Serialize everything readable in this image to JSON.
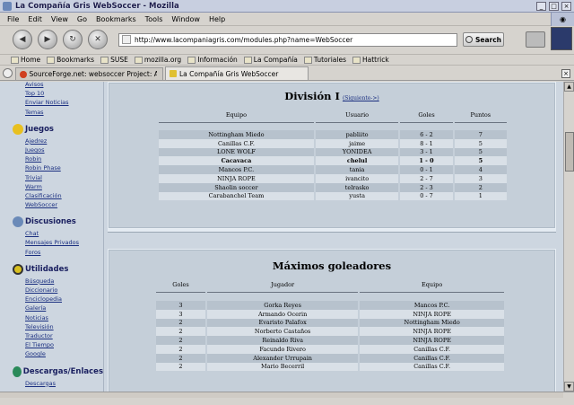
{
  "window": {
    "title": "La Compañía Gris WebSoccer - Mozilla"
  },
  "menu": [
    "File",
    "Edit",
    "View",
    "Go",
    "Bookmarks",
    "Tools",
    "Window",
    "Help"
  ],
  "nav": {
    "url": "http://www.lacompaniagris.com/modules.php?name=WebSoccer",
    "search_label": "Search"
  },
  "bookmarks": [
    "Home",
    "Bookmarks",
    "SUSE",
    "mozilla.org",
    "Información",
    "La Compañía",
    "Tutoriales",
    "Hattrick"
  ],
  "tabs": [
    "SourceForge.net: websoccer Project: A...",
    "La Compañía Gris WebSoccer"
  ],
  "sidebar": {
    "top_links": [
      "Avisos",
      "Top 10",
      "Enviar Noticias",
      "Temas"
    ],
    "sections": [
      {
        "title": "Juegos",
        "links": [
          "Ajedrez",
          "Juegos",
          "Robin",
          "Robin Phase",
          "Trivial",
          "Warm",
          "Clasificación",
          "WebSoccer"
        ]
      },
      {
        "title": "Discusiones",
        "links": [
          "Chat",
          "Mensajes Privados",
          "Foros"
        ]
      },
      {
        "title": "Utilidades",
        "links": [
          "Búsqueda",
          "Diccionario",
          "Enciclopedia",
          "Galería",
          "Noticias",
          "Televisión",
          "Traductor",
          "El Tiempo",
          "Google"
        ]
      },
      {
        "title": "Descargas/Enlaces",
        "links": [
          "Descargas"
        ]
      }
    ]
  },
  "division": {
    "title": "División I",
    "next_link": "(Siguiente->)",
    "headers": [
      "Equipo",
      "Usuario",
      "Goles",
      "Puntos"
    ],
    "rows": [
      [
        "Nottingham Miedo",
        "pabliito",
        "6 - 2",
        "7"
      ],
      [
        "Canillas C.F.",
        "jaime",
        "8 - 1",
        "5"
      ],
      [
        "LONE WOLF",
        "YONIDEA",
        "3 - 1",
        "5"
      ],
      [
        "Cacavaca",
        "chelul",
        "1 - 0",
        "5"
      ],
      [
        "Mancos P.C.",
        "tania",
        "0 - 1",
        "4"
      ],
      [
        "NINJA ROPE",
        "ivancito",
        "2 - 7",
        "3"
      ],
      [
        "Shaolin soccer",
        "telrasko",
        "2 - 3",
        "2"
      ],
      [
        "Carabanchel Team",
        "yusta",
        "0 - 7",
        "1"
      ]
    ]
  },
  "scorers": {
    "title": "Máximos goleadores",
    "headers": [
      "Goles",
      "Jugador",
      "Equipo"
    ],
    "rows": [
      [
        "3",
        "Gorka Reyes",
        "Mancos P.C."
      ],
      [
        "3",
        "Armando Ocerin",
        "NINJA ROPE"
      ],
      [
        "2",
        "Evaristo Palafox",
        "Nottingham Miedo"
      ],
      [
        "2",
        "Norberto Castaños",
        "NINJA ROPE"
      ],
      [
        "2",
        "Reinaldo Riva",
        "NINJA ROPE"
      ],
      [
        "2",
        "Facundo Rivero",
        "Canillas C.F."
      ],
      [
        "2",
        "Alexander Urrupain",
        "Canillas C.F."
      ],
      [
        "2",
        "Mario Becerril",
        "Canillas C.F."
      ]
    ]
  }
}
